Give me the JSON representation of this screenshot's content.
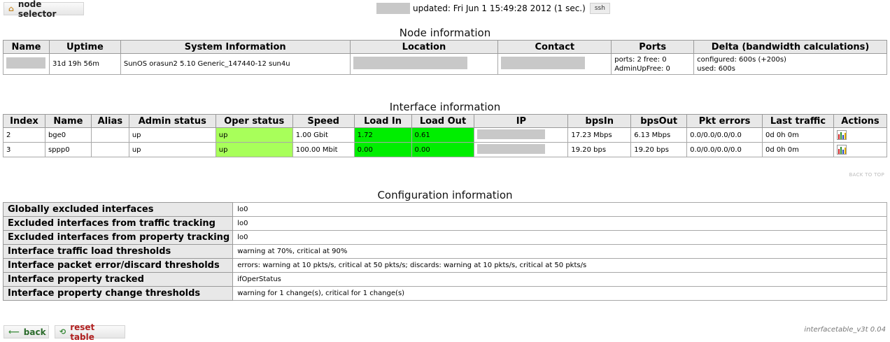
{
  "top": {
    "node_selector_label": "node selector",
    "updated_text": "updated: Fri Jun 1 15:49:28 2012 (1 sec.)",
    "ssh_label": "ssh"
  },
  "node_info": {
    "title": "Node information",
    "headers": [
      "Name",
      "Uptime",
      "System Information",
      "Location",
      "Contact",
      "Ports",
      "Delta (bandwidth calculations)"
    ],
    "row": {
      "uptime": "31d 19h 56m",
      "system_info": "SunOS orasun2 5.10 Generic_147440-12 sun4u",
      "ports_line1": "ports: 2 free: 0",
      "ports_line2": "AdminUpFree: 0",
      "delta_line1": "configured: 600s (+200s)",
      "delta_line2": "used: 600s"
    }
  },
  "interface_info": {
    "title": "Interface information",
    "headers": [
      "Index",
      "Name",
      "Alias",
      "Admin status",
      "Oper status",
      "Speed",
      "Load In",
      "Load Out",
      "IP",
      "bpsIn",
      "bpsOut",
      "Pkt errors",
      "Last traffic",
      "Actions"
    ],
    "rows": [
      {
        "index": "2",
        "name": "bge0",
        "alias": "",
        "admin": "up",
        "oper": "up",
        "speed": "1.00 Gbit",
        "load_in": "1.72",
        "load_out": "0.61",
        "bps_in": "17.23 Mbps",
        "bps_out": "6.13 Mbps",
        "pkt_errors": "0.0/0.0/0.0/0.0",
        "last_traffic": "0d 0h 0m"
      },
      {
        "index": "3",
        "name": "sppp0",
        "alias": "",
        "admin": "up",
        "oper": "up",
        "speed": "100.00 Mbit",
        "load_in": "0.00",
        "load_out": "0.00",
        "bps_in": "19.20 bps",
        "bps_out": "19.20 bps",
        "pkt_errors": "0.0/0.0/0.0/0.0",
        "last_traffic": "0d 0h 0m"
      }
    ],
    "back_to_top": "BACK TO TOP"
  },
  "config_info": {
    "title": "Configuration information",
    "rows": [
      {
        "key": "Globally excluded interfaces",
        "value": "lo0"
      },
      {
        "key": "Excluded interfaces from traffic tracking",
        "value": "lo0"
      },
      {
        "key": "Excluded interfaces from property tracking",
        "value": "lo0"
      },
      {
        "key": "Interface traffic load thresholds",
        "value": "warning at 70%, critical at 90%"
      },
      {
        "key": "Interface packet error/discard thresholds",
        "value": "errors: warning at 10 pkts/s, critical at 50 pkts/s; discards: warning at 10 pkts/s, critical at 50 pkts/s"
      },
      {
        "key": "Interface property tracked",
        "value": "ifOperStatus"
      },
      {
        "key": "Interface property change thresholds",
        "value": "warning for 1 change(s), critical for 1 change(s)"
      }
    ]
  },
  "footer": {
    "back_label": "back",
    "reset_label": "reset table",
    "version": "interfacetable_v3t 0.04"
  },
  "colors": {
    "load_ok": "#00ee00",
    "oper_up": "#a8ff5a",
    "header_bg": "#e8e8e8"
  },
  "icons": {
    "node_selector": "home-icon",
    "ssh": "ssh-button",
    "actions": "bar-chart-icon",
    "back": "arrow-left-icon",
    "reset": "reset-icon"
  }
}
